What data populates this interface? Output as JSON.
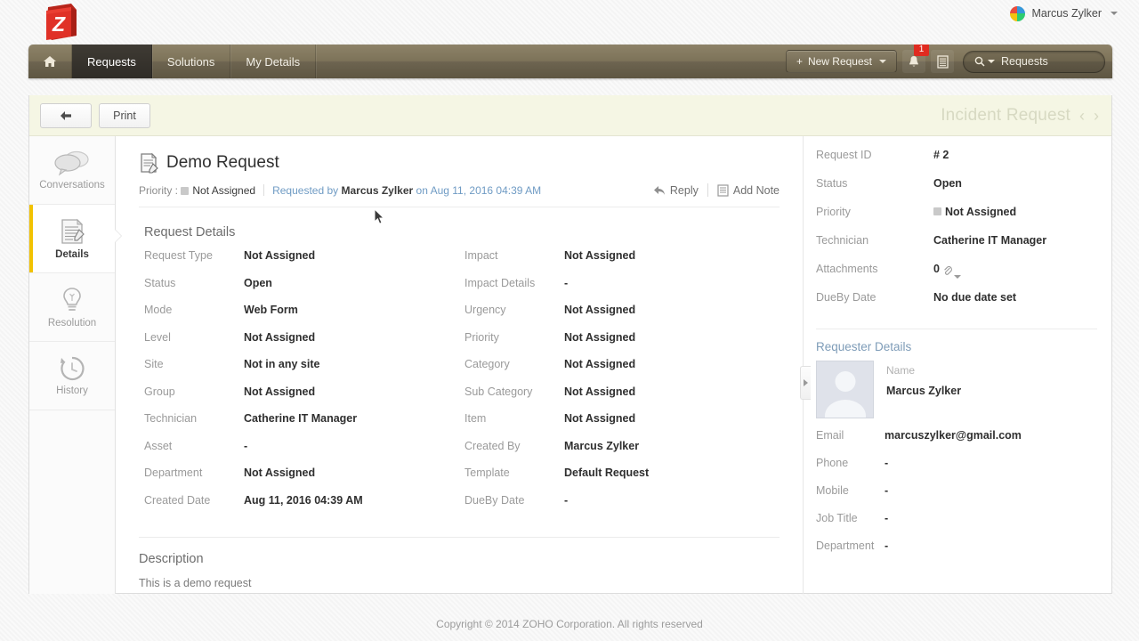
{
  "topbar": {
    "logo_icon": "zoho-logo-icon",
    "user_name": "Marcus Zylker",
    "user_caret_icon": "caret-down-icon"
  },
  "nav": {
    "home_icon": "home-icon",
    "items": [
      {
        "label": "Requests",
        "active": true
      },
      {
        "label": "Solutions",
        "active": false
      },
      {
        "label": "My Details",
        "active": false
      }
    ],
    "new_request_label": "New Request",
    "new_request_plus": "+",
    "new_request_caret_icon": "caret-down-icon",
    "bell_icon": "bell-icon",
    "bell_badge": "1",
    "list_icon": "list-icon",
    "search_icon": "search-icon",
    "search_caret_icon": "caret-down-icon",
    "search_value": "Requests"
  },
  "actionbar": {
    "back_icon": "back-arrow-icon",
    "print_label": "Print",
    "title": "Incident Request",
    "prev_icon": "chevron-left-icon",
    "next_icon": "chevron-right-icon",
    "prev_glyph": "‹",
    "next_glyph": "›"
  },
  "rail": {
    "items": [
      {
        "label": "Conversations",
        "icon": "conversations-icon",
        "active": false
      },
      {
        "label": "Details",
        "icon": "details-icon",
        "active": true
      },
      {
        "label": "Resolution",
        "icon": "lightbulb-icon",
        "active": false
      },
      {
        "label": "History",
        "icon": "history-icon",
        "active": false
      }
    ]
  },
  "request": {
    "title_icon": "request-document-icon",
    "title": "Demo Request",
    "priority_label": "Priority :",
    "priority_value": "Not Assigned",
    "requested_by_label": "Requested by",
    "requester": "Marcus Zylker",
    "on_label": "on",
    "requested_on": "Aug 11, 2016 04:39 AM",
    "reply_label": "Reply",
    "reply_icon": "reply-arrow-icon",
    "add_note_label": "Add Note",
    "add_note_icon": "note-icon",
    "details_heading": "Request Details",
    "left_fields": [
      {
        "label": "Request Type",
        "value": "Not Assigned"
      },
      {
        "label": "Status",
        "value": "Open"
      },
      {
        "label": "Mode",
        "value": "Web Form"
      },
      {
        "label": "Level",
        "value": "Not Assigned"
      },
      {
        "label": "Site",
        "value": "Not in any site"
      },
      {
        "label": "Group",
        "value": "Not Assigned"
      },
      {
        "label": "Technician",
        "value": "Catherine IT Manager"
      },
      {
        "label": "Asset",
        "value": "-"
      },
      {
        "label": "Department",
        "value": "Not Assigned"
      },
      {
        "label": "Created Date",
        "value": "Aug 11, 2016 04:39 AM"
      }
    ],
    "right_fields": [
      {
        "label": "Impact",
        "value": "Not Assigned"
      },
      {
        "label": "Impact Details",
        "value": "-"
      },
      {
        "label": "Urgency",
        "value": "Not Assigned"
      },
      {
        "label": "Priority",
        "value": "Not Assigned"
      },
      {
        "label": "Category",
        "value": "Not Assigned"
      },
      {
        "label": "Sub Category",
        "value": "Not Assigned"
      },
      {
        "label": "Item",
        "value": "Not Assigned"
      },
      {
        "label": "Created By",
        "value": "Marcus Zylker"
      },
      {
        "label": "Template",
        "value": "Default Request"
      },
      {
        "label": "DueBy Date",
        "value": "-"
      }
    ],
    "description_heading": "Description",
    "description_body": "This is a demo request",
    "collapse_icon": "collapse-panel-icon"
  },
  "summary": {
    "fields": [
      {
        "label": "Request ID",
        "value": "# 2",
        "swatch": false,
        "clip": false
      },
      {
        "label": "Status",
        "value": "Open",
        "swatch": false,
        "clip": false
      },
      {
        "label": "Priority",
        "value": "Not Assigned",
        "swatch": true,
        "clip": false
      },
      {
        "label": "Technician",
        "value": "Catherine IT Manager",
        "swatch": false,
        "clip": false
      },
      {
        "label": "Attachments",
        "value": "0",
        "swatch": false,
        "clip": true
      },
      {
        "label": "DueBy Date",
        "value": "No due date set",
        "swatch": false,
        "clip": false
      }
    ]
  },
  "requester_details": {
    "heading": "Requester Details",
    "avatar_icon": "avatar-placeholder-icon",
    "name_label": "Name",
    "name_value": "Marcus Zylker",
    "fields": [
      {
        "label": "Email",
        "value": "marcuszylker@gmail.com"
      },
      {
        "label": "Phone",
        "value": "-"
      },
      {
        "label": "Mobile",
        "value": "-"
      },
      {
        "label": "Job Title",
        "value": "-"
      },
      {
        "label": "Department",
        "value": "-"
      }
    ]
  },
  "footer": {
    "copyright": "Copyright © 2014 ZOHO Corporation. All rights reserved"
  },
  "colors": {
    "nav_bg": "#7d7359",
    "nav_active": "#332f29",
    "accent_yellow": "#f2c200",
    "actionbar_bg": "#f5f6e4",
    "badge_red": "#e02b20",
    "link_blue": "#6f9bc4",
    "logo_red": "#dd2e1f"
  }
}
